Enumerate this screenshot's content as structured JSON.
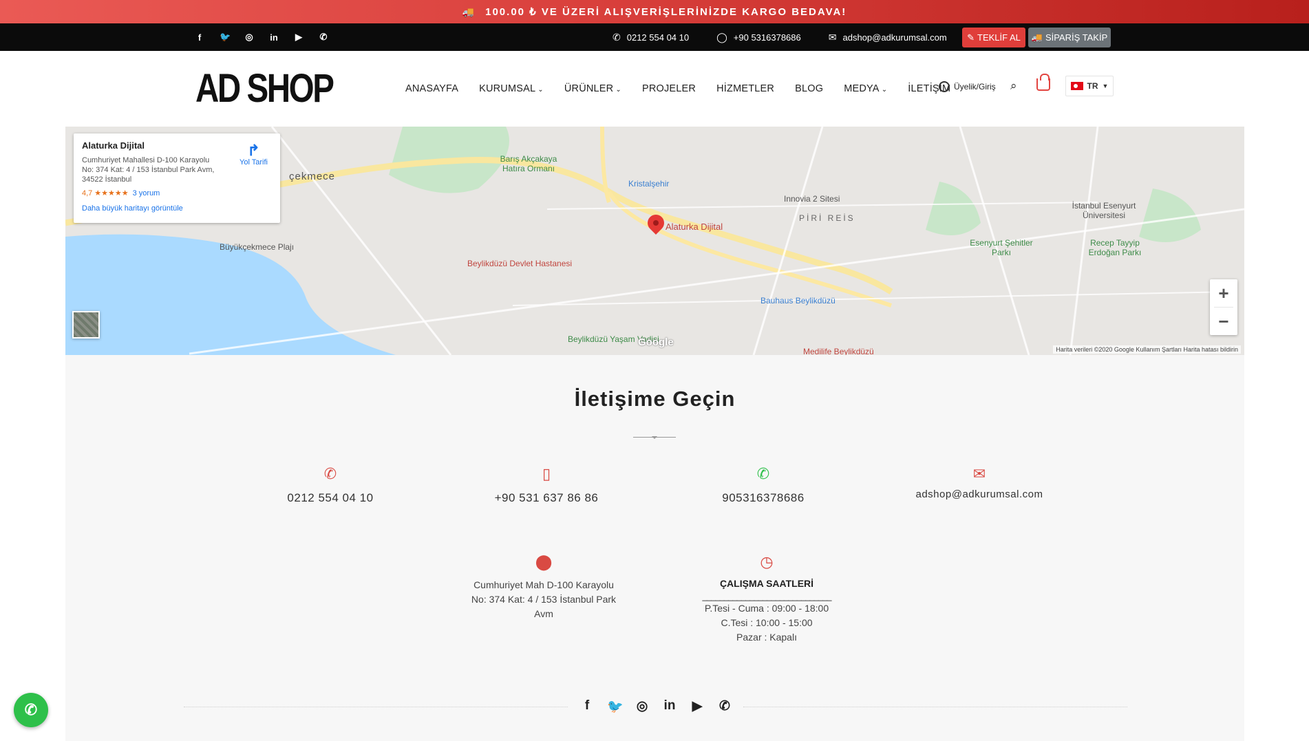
{
  "promo": {
    "icon": "truck-icon",
    "text": "100.00 ₺ VE ÜZERİ ALIŞVERİŞLERİNİZDE KARGO BEDAVA!"
  },
  "topbar": {
    "socials": [
      {
        "name": "facebook-icon",
        "glyph": "f"
      },
      {
        "name": "twitter-icon",
        "glyph": "🐦"
      },
      {
        "name": "instagram-icon",
        "glyph": "◎"
      },
      {
        "name": "linkedin-icon",
        "glyph": "in"
      },
      {
        "name": "youtube-icon",
        "glyph": "▶"
      },
      {
        "name": "whatsapp-icon",
        "glyph": "✆"
      }
    ],
    "phone": "0212 554 04 10",
    "whatsapp": "+90 5316378686",
    "email": "adshop@adkurumsal.com",
    "quote_button": "TEKLİF AL",
    "order_button": "SİPARİŞ TAKİP"
  },
  "header": {
    "logo": "AD SHOP",
    "nav": [
      "ANASAYFA",
      "KURUMSAL",
      "ÜRÜNLER",
      "PROJELER",
      "HİZMETLER",
      "BLOG",
      "MEDYA",
      "İLETİŞİM"
    ],
    "user_label": "Üyelik/Giriş",
    "lang": "TR"
  },
  "map": {
    "card_title": "Alaturka Dijital",
    "card_address": "Cumhuriyet Mahallesi D-100 Karayolu No: 374 Kat: 4 / 153 İstanbul Park Avm, 34522 İstanbul",
    "rating": "4,7",
    "stars": "★★★★★",
    "reviews": "3 yorum",
    "directions": "Yol Tarifi",
    "bigger_map": "Daha büyük haritayı görüntüle",
    "pin_label": "Alaturka Dijital",
    "footer": "Harita verileri ©2020 Google   Kullanım Şartları   Harita hatası bildirin",
    "google": "Google",
    "labels": {
      "l1": "Barış Akçakaya Hatıra Ormanı",
      "l2": "Kristalşehir",
      "l3": "Innovia 2 Sitesi",
      "l4": "PİRİ REİS",
      "l5": "İstanbul Esenyurt Üniversitesi",
      "l6": "Esenyurt Şehitler Parkı",
      "l7": "Recep Tayyip Erdoğan Parkı",
      "l8": "Büyükçekmece Plajı",
      "l9": "Beylikdüzü Devlet Hastanesi",
      "l10": "Bauhaus Beylikdüzü",
      "l11": "Beylikdüzü Yaşam Vadisi",
      "l12": "Medilife Beylikdüzü",
      "l13": "çekmece"
    }
  },
  "contact": {
    "title": "İletişime Geçin",
    "phone": "0212 554 04 10",
    "mobile": "+90 531 637 86 86",
    "whatsapp": "905316378686",
    "email": "adshop@adkurumsal.com",
    "address_line1": "Cumhuriyet Mah D-100 Karayolu",
    "address_line2": "No: 374 Kat: 4 / 153 İstanbul Park",
    "address_line3": "Avm",
    "hours_title": "ÇALIŞMA SAATLERİ",
    "hours_dash": "______________________________",
    "hours_1": "P.Tesi - Cuma : 09:00 - 18:00",
    "hours_2": "C.Tesi : 10:00 - 15:00",
    "hours_3": "Pazar : Kapalı"
  },
  "colors": {
    "accent": "#d94a43",
    "promo": "#d9403c",
    "whatsapp": "#2ec04a"
  }
}
